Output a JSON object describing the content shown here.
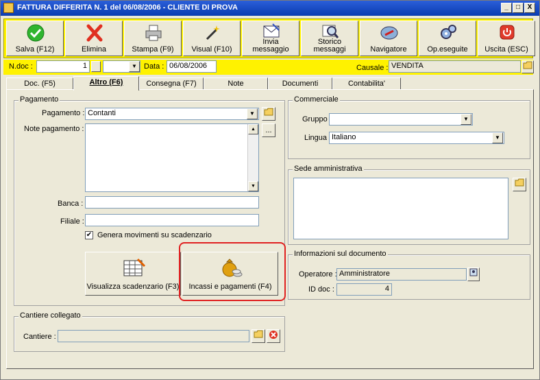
{
  "window": {
    "title": "FATTURA DIFFERITA N. 1  del 06/08/2006 - CLIENTE DI PROVA",
    "min": "_",
    "max": "□",
    "close": "X"
  },
  "toolbar": {
    "save": "Salva (F12)",
    "delete": "Elimina",
    "print": "Stampa (F9)",
    "preview": "Visual (F10)",
    "send_line1": "Invia",
    "send_line2": "messaggio",
    "history_line1": "Storico",
    "history_line2": "messaggi",
    "navigator": "Navigatore",
    "operations": "Op.eseguite",
    "exit": "Uscita (ESC)"
  },
  "header": {
    "ndoc_label": "N.doc :",
    "ndoc_value": "1",
    "data_label": "Data :",
    "data_value": "06/08/2006",
    "causale_label": "Causale :",
    "causale_value": "VENDITA"
  },
  "tabs": [
    "Doc. (F5)",
    "Altro (F6)",
    "Consegna (F7)",
    "Note",
    "Documenti",
    "Contabilita'"
  ],
  "pagamento": {
    "group_title": "Pagamento",
    "pagamento_label": "Pagamento :",
    "pagamento_value": "Contanti",
    "note_label": "Note pagamento :",
    "note_value": "",
    "ellipsis": "...",
    "banca_label": "Banca :",
    "banca_value": "",
    "filiale_label": "Filiale :",
    "filiale_value": "",
    "genera_label": "Genera movimenti su scadenzario",
    "genera_checked": true,
    "visualizza_btn": "Visualizza scadenzario (F3)",
    "incassi_btn": "Incassi e pagamenti (F4)"
  },
  "commerciale": {
    "group_title": "Commerciale",
    "gruppo_label": "Gruppo",
    "gruppo_value": "",
    "lingua_label": "Lingua",
    "lingua_value": "Italiano"
  },
  "sede": {
    "group_title": "Sede amministrativa",
    "value": ""
  },
  "info": {
    "group_title": "Informazioni sul documento",
    "operatore_label": "Operatore :",
    "operatore_value": "Amministratore",
    "iddoc_label": "ID doc :",
    "iddoc_value": "4"
  },
  "cantiere": {
    "group_title": "Cantiere collegato",
    "label": "Cantiere :",
    "value": ""
  },
  "colors": {
    "toolbar_bg": "#fff200",
    "window_bg": "#ece9d8",
    "highlight": "#e02020"
  }
}
